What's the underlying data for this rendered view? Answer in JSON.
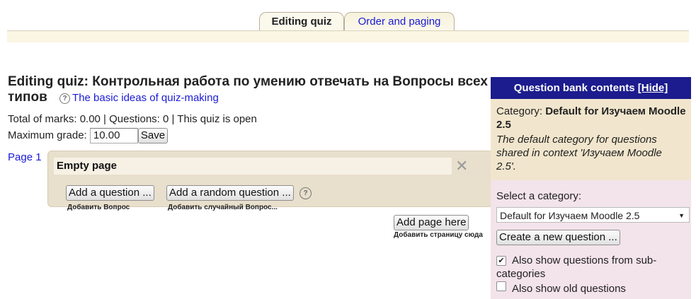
{
  "tabs": {
    "active": "Editing quiz",
    "other": "Order and paging"
  },
  "quiz": {
    "title": "Editing quiz: Контрольная работа по умению отвечать на Вопросы всех типов",
    "help_link": "The basic ideas of quiz-making",
    "summary": "Total of marks: 0.00 | Questions: 0 | This quiz is open",
    "max_grade_label": "Maximum grade:",
    "max_grade_value": "10.00",
    "save_label": "Save"
  },
  "page": {
    "label": "Page 1",
    "empty_label": "Empty page",
    "add_question": "Add a question ...",
    "add_question_hint": "Добавить Вопрос",
    "add_random": "Add a random question ...",
    "add_random_hint": "Добавить случайный Вопрос...",
    "add_page": "Add page here",
    "add_page_hint": "Добавить страницу сюда"
  },
  "bank": {
    "header": "Question bank contents",
    "hide": "[Hide]",
    "category_label": "Category:",
    "category_name": "Default for Изучаем Moodle 2.5",
    "category_desc": "The default category for questions shared in context 'Изучаем Moodle 2.5'.",
    "select_label": "Select a category:",
    "select_value": "Default for Изучаем Moodle 2.5",
    "create_button": "Create a new question ...",
    "show_sub": "Also show questions from sub-categories",
    "show_sub_checked": true,
    "show_old": "Also show old questions",
    "show_old_checked": false
  }
}
